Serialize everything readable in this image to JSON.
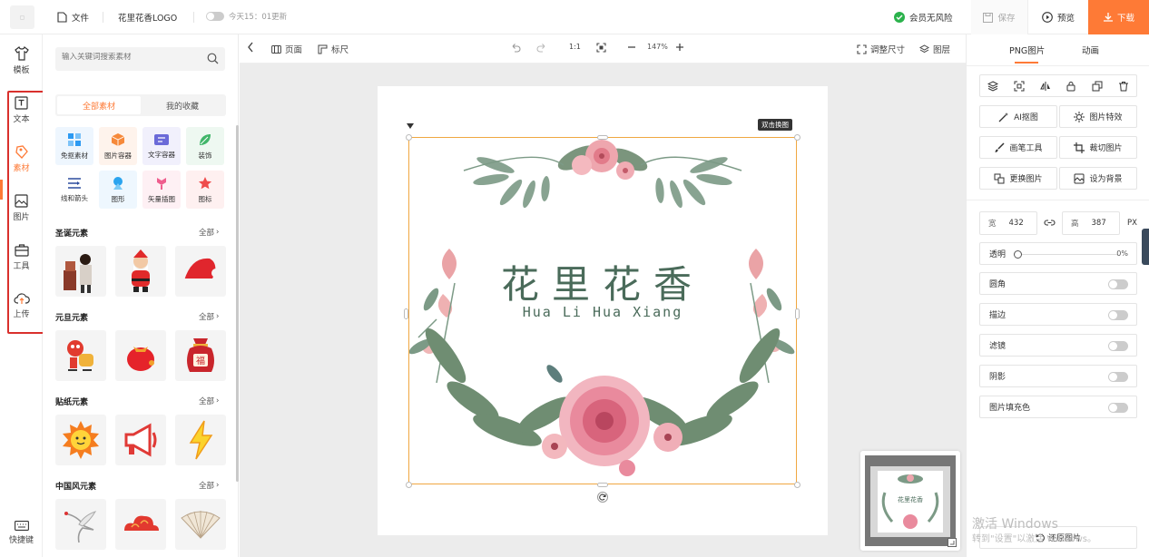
{
  "topbar": {
    "file_label": "文件",
    "doc_title": "花里花香LOGO",
    "autosave_text": "今天15：01更新",
    "member_text": "会员无风险",
    "save_label": "保存",
    "preview_label": "预览",
    "download_label": "下载",
    "accent_color": "#fe7a36",
    "member_icon_color": "#2bb24c"
  },
  "leftnav": {
    "items": [
      {
        "label": "模板",
        "icon": "tshirt-icon"
      },
      {
        "label": "文本",
        "icon": "text-icon"
      },
      {
        "label": "素材",
        "icon": "material-icon"
      },
      {
        "label": "图片",
        "icon": "image-icon"
      },
      {
        "label": "工具",
        "icon": "toolbox-icon"
      },
      {
        "label": "上传",
        "icon": "cloud-upload-icon"
      }
    ],
    "shortcut_label": "快捷键",
    "highlight_color": "#d9302c"
  },
  "panel": {
    "search_placeholder": "输入关键词搜索素材",
    "tabs": [
      "全部素材",
      "我的收藏"
    ],
    "categories": [
      {
        "label": "免抠素材",
        "icon": "cutout-icon",
        "color": "#2d9af2"
      },
      {
        "label": "图片容器",
        "icon": "box-icon",
        "color": "#f6893a"
      },
      {
        "label": "文字容器",
        "icon": "textbox-icon",
        "color": "#6b6ad8"
      },
      {
        "label": "装饰",
        "icon": "leaf-icon",
        "color": "#41b66a"
      },
      {
        "label": "线和箭头",
        "icon": "lines-icon",
        "color": "#2b4c9e"
      },
      {
        "label": "图形",
        "icon": "shape-icon",
        "color": "#2ba4ef"
      },
      {
        "label": "矢量插图",
        "icon": "vector-icon",
        "color": "#ef5e8e"
      },
      {
        "label": "图标",
        "icon": "star-icon",
        "color": "#ef4c4c"
      }
    ],
    "sections": [
      {
        "title": "圣诞元素",
        "more": "全部"
      },
      {
        "title": "元旦元素",
        "more": "全部"
      },
      {
        "title": "贴纸元素",
        "more": "全部"
      },
      {
        "title": "中国风元素",
        "more": "全部"
      }
    ]
  },
  "canvas_toolbar": {
    "page_label": "页面",
    "ruler_label": "标尺",
    "ratio_label": "1:1",
    "zoom": "147%",
    "resize_label": "调整尺寸",
    "layers_label": "图层"
  },
  "canvas": {
    "logo_title": "花里花香",
    "logo_subtitle": "Hua Li Hua Xiang",
    "hint": "双击换图"
  },
  "rpanel": {
    "tabs": [
      "PNG图片",
      "动画"
    ],
    "buttons": [
      {
        "label": "AI抠图",
        "icon": "magic-wand-icon"
      },
      {
        "label": "图片特效",
        "icon": "sparkle-gear-icon"
      },
      {
        "label": "画笔工具",
        "icon": "brush-icon"
      },
      {
        "label": "裁切图片",
        "icon": "crop-icon"
      },
      {
        "label": "更换图片",
        "icon": "replace-image-icon"
      },
      {
        "label": "设为背景",
        "icon": "set-background-icon"
      }
    ],
    "width_label": "宽",
    "width_value": "432",
    "height_label": "高",
    "height_value": "387",
    "unit": "PX",
    "opacity_label": "透明",
    "opacity_value": "0%",
    "toggles": [
      "圆角",
      "描边",
      "滤镜",
      "阴影",
      "图片填充色"
    ],
    "restore_label": "还原图片"
  },
  "watermark": {
    "line1": "激活 Windows",
    "line2": "转到\"设置\"以激活 Windows。"
  }
}
